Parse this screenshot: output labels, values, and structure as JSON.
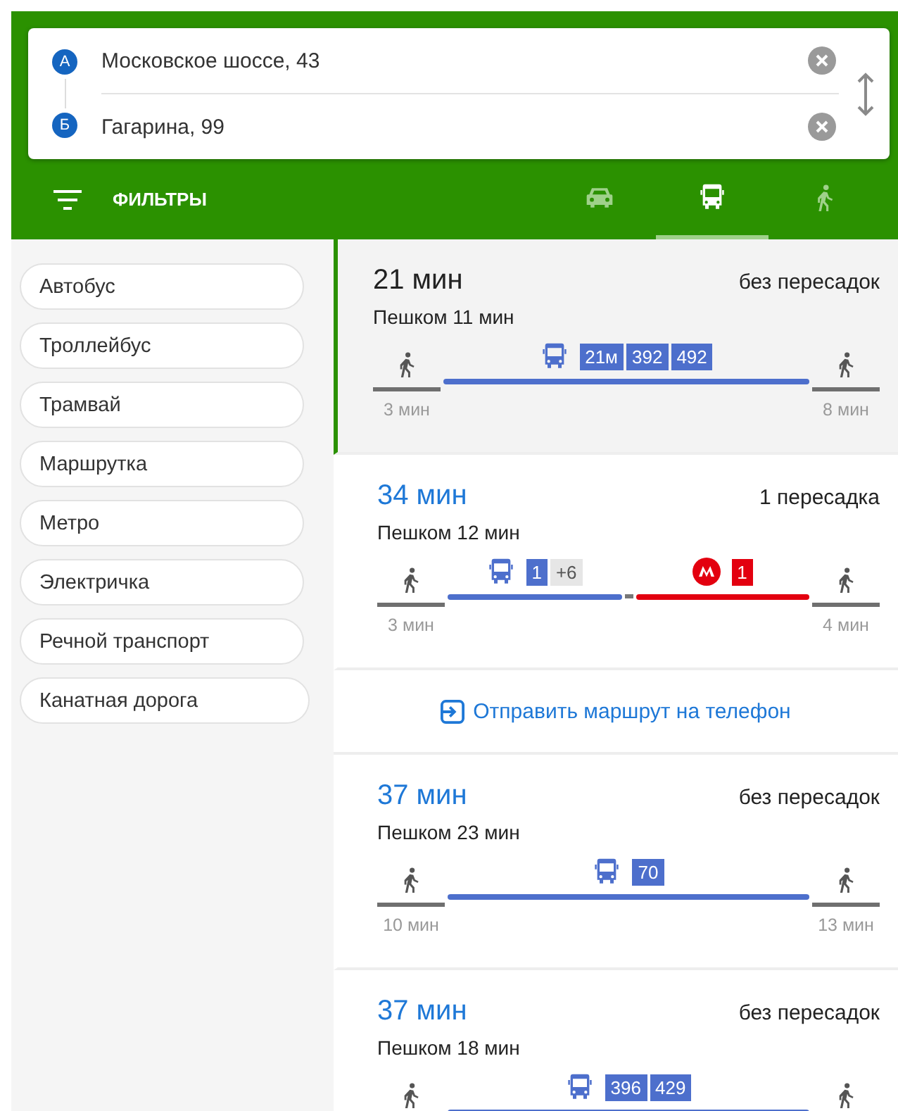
{
  "search": {
    "from": {
      "marker": "А",
      "value": "Московское шоссе, 43"
    },
    "to": {
      "marker": "Б",
      "value": "Гагарина, 99"
    }
  },
  "filters_label": "ФИЛЬТРЫ",
  "modes": [
    {
      "kind": "car",
      "selected": false
    },
    {
      "kind": "bus",
      "selected": true
    },
    {
      "kind": "walk",
      "selected": false
    }
  ],
  "filters": [
    "Автобус",
    "Троллейбус",
    "Трамвай",
    "Маршрутка",
    "Метро",
    "Электричка",
    "Речной транспорт",
    "Канатная дорога"
  ],
  "results": [
    {
      "kind": "route",
      "selected": true,
      "duration": "21 мин",
      "transfers": "без пересадок",
      "walk": "Пешком 11 мин",
      "segments": [
        {
          "kind": "walk",
          "time": "3 мин"
        },
        {
          "kind": "bus",
          "numbers": [
            "21м",
            "392",
            "492"
          ]
        },
        {
          "kind": "walk",
          "time": "8 мин"
        }
      ]
    },
    {
      "kind": "route",
      "selected": false,
      "duration": "34 мин",
      "transfers": "1 пересадка",
      "walk": "Пешком 12 мин",
      "segments": [
        {
          "kind": "walk",
          "time": "3 мин"
        },
        {
          "kind": "bus",
          "numbers": [
            "1"
          ],
          "more": "+6"
        },
        {
          "kind": "metro",
          "numbers": [
            "1"
          ]
        },
        {
          "kind": "walk",
          "time": "4 мин"
        }
      ]
    },
    {
      "kind": "link",
      "text": "Отправить маршрут на телефон"
    },
    {
      "kind": "route",
      "selected": false,
      "duration": "37 мин",
      "transfers": "без пересадок",
      "walk": "Пешком 23 мин",
      "segments": [
        {
          "kind": "walk",
          "time": "10 мин"
        },
        {
          "kind": "bus",
          "numbers": [
            "70"
          ]
        },
        {
          "kind": "walk",
          "time": "13 мин"
        }
      ]
    },
    {
      "kind": "route",
      "selected": false,
      "duration": "37 мин",
      "transfers": "без пересадок",
      "walk": "Пешком 18 мин",
      "segments": [
        {
          "kind": "walk"
        },
        {
          "kind": "bus",
          "numbers": [
            "396",
            "429"
          ]
        },
        {
          "kind": "walk"
        }
      ]
    }
  ]
}
